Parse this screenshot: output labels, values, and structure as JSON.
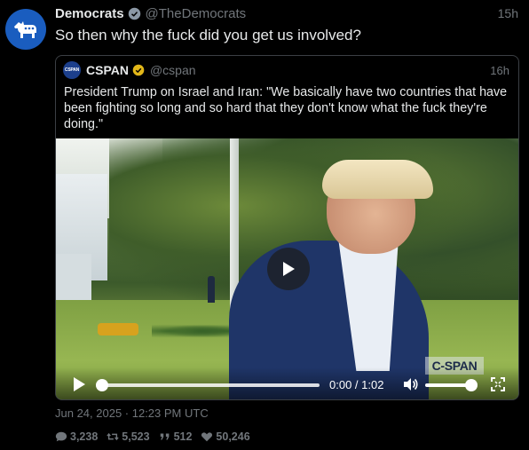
{
  "tweet": {
    "author_name": "Democrats",
    "author_handle": "@TheDemocrats",
    "time": "15h",
    "text": "So then why the fuck did you get us involved?",
    "date": "Jun 24, 2025 · 12:23 PM UTC"
  },
  "quote": {
    "author_name": "CSPAN",
    "author_handle": "@cspan",
    "avatar_text": "CSPAN",
    "time": "16h",
    "text": "President Trump on Israel and Iran: \"We basically have two countries that have been fighting so long and so hard that they don't know what the fuck they're doing.\"",
    "video": {
      "watermark": "C-SPAN",
      "time_display": "0:00 / 1:02",
      "progress": 0,
      "volume": 0.92
    }
  },
  "stats": {
    "replies": "3,238",
    "retweets": "5,523",
    "quotes": "512",
    "likes": "50,246"
  },
  "icons": {
    "avatar": "donkey-icon",
    "verified": "verified-badge-icon",
    "gold_verified": "gold-verified-badge-icon",
    "play": "play-icon",
    "volume": "volume-icon",
    "fullscreen": "fullscreen-icon",
    "reply": "comment-icon",
    "retweet": "retweet-icon",
    "quote": "quote-icon",
    "like": "heart-icon"
  },
  "colors": {
    "background": "#000000",
    "text": "#e7e9ea",
    "muted": "#71767b",
    "democrats_blue": "#1a5dbf",
    "verified_blue": "#1d9bf0",
    "gold": "#e2b719"
  }
}
